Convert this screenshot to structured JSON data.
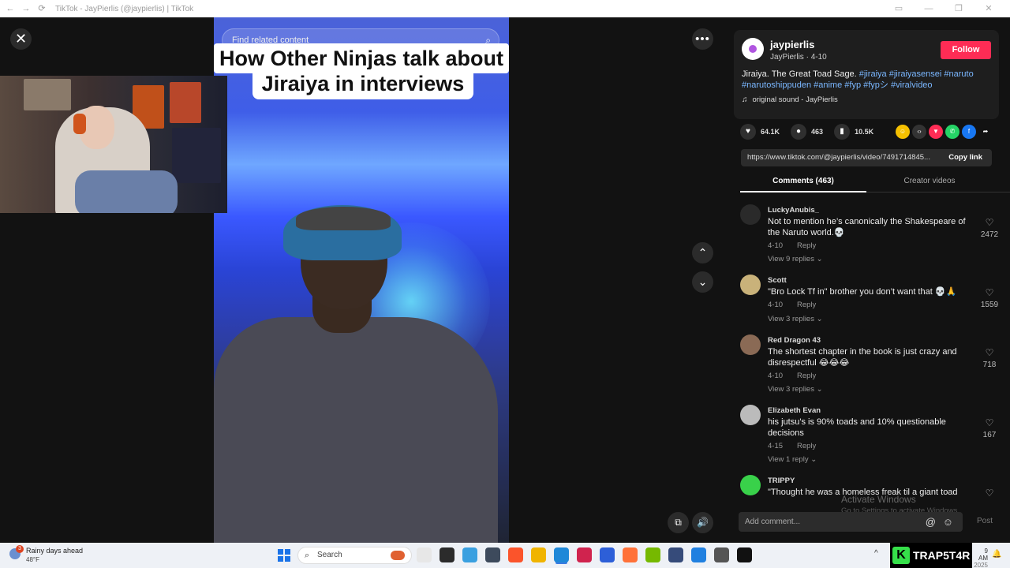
{
  "window": {
    "title": "TikTok - JayPierlis (@jaypierlis) | TikTok",
    "nav": [
      "←",
      "→",
      "⟳"
    ],
    "controls": [
      "▭",
      "—",
      "❐",
      "✕"
    ]
  },
  "video": {
    "search_placeholder": "Find related content",
    "caption_line1": "How Other Ninjas talk about",
    "caption_line2": "Jiraiya in interviews"
  },
  "stage_controls": {
    "close": "✕",
    "more": "•••",
    "up": "⌃",
    "down": "⌄",
    "pip": "⧉",
    "volume": "🔊"
  },
  "post": {
    "username": "jaypierlis",
    "display_name": "JayPierlis",
    "date": "4-10",
    "desc_text": "Jiraiya. The Great Toad Sage. ",
    "desc_tags": "#jiraiya #jiraiyasensei #naruto #narutoshippuden #anime #fyp #fypシ #viralvideo",
    "sound": "original sound - JayPierlis",
    "follow_label": "Follow"
  },
  "stats": {
    "likes": "64.1K",
    "comments": "463",
    "saves": "10.5K"
  },
  "link": {
    "url": "https://www.tiktok.com/@jaypierlis/video/7491714845...",
    "copy_label": "Copy link"
  },
  "tabs": [
    {
      "label": "Comments (463)"
    },
    {
      "label": "Creator videos"
    }
  ],
  "comments": [
    {
      "name": "LuckyAnubis_",
      "text": "Not to mention he’s canonically the Shakespeare of the Naruto world.💀",
      "date": "4-10",
      "reply": "Reply",
      "view": "View 9 replies ⌄",
      "likes": "2472"
    },
    {
      "name": "Scott",
      "text": "\"Bro Lock Tf in\" brother you don’t want that 💀🙏",
      "date": "4-10",
      "reply": "Reply",
      "view": "View 3 replies ⌄",
      "likes": "1559"
    },
    {
      "name": "Red Dragon 43",
      "text": "The shortest chapter in the book is just crazy and disrespectful 😂😂😂",
      "date": "4-10",
      "reply": "Reply",
      "view": "View 3 replies ⌄",
      "likes": "718"
    },
    {
      "name": "Elizabeth Evan",
      "text": "his jutsu's is 90% toads and 10% questionable decisions",
      "date": "4-15",
      "reply": "Reply",
      "view": "View 1 reply ⌄",
      "likes": "167"
    },
    {
      "name": "TRIPPY",
      "text": "\"Thought he was a homeless freak til a giant toad",
      "date": "",
      "reply": "",
      "view": "",
      "likes": ""
    }
  ],
  "watermark": {
    "line1": "Activate Windows",
    "line2": "Go to Settings to activate Windows."
  },
  "composer": {
    "placeholder": "Add comment...",
    "at": "@",
    "emoji": "☺",
    "post_label": "Post"
  },
  "taskbar": {
    "weather_title": "Rainy days ahead",
    "weather_temp": "48°F",
    "weather_badge": "3",
    "search_label": "Search",
    "tray_arrow": "^",
    "brand": "TRAP5T4R",
    "brand_k": "K",
    "clock_time": "9 AM",
    "clock_date": "2025",
    "notif": "🔔",
    "app_colors": [
      "#e7e7e7",
      "#2b2b2b",
      "#3aa0e0",
      "#3d4a5c",
      "#fb542b",
      "#f0b400",
      "#1f88d8",
      "#d0234e",
      "#2d5fd8",
      "#ff7139",
      "#76b900",
      "#364b7a",
      "#2080e0",
      "#555555",
      "#111111"
    ]
  }
}
